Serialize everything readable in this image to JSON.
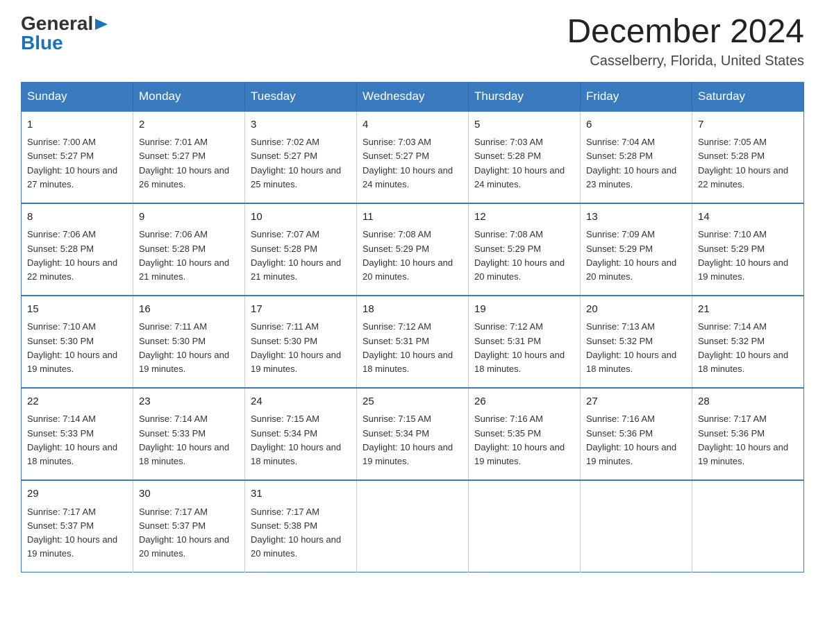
{
  "logo": {
    "general": "General",
    "blue": "Blue",
    "triangle": "▶"
  },
  "header": {
    "title": "December 2024",
    "subtitle": "Casselberry, Florida, United States"
  },
  "weekdays": [
    "Sunday",
    "Monday",
    "Tuesday",
    "Wednesday",
    "Thursday",
    "Friday",
    "Saturday"
  ],
  "weeks": [
    [
      {
        "day": "1",
        "sunrise": "7:00 AM",
        "sunset": "5:27 PM",
        "daylight": "10 hours and 27 minutes."
      },
      {
        "day": "2",
        "sunrise": "7:01 AM",
        "sunset": "5:27 PM",
        "daylight": "10 hours and 26 minutes."
      },
      {
        "day": "3",
        "sunrise": "7:02 AM",
        "sunset": "5:27 PM",
        "daylight": "10 hours and 25 minutes."
      },
      {
        "day": "4",
        "sunrise": "7:03 AM",
        "sunset": "5:27 PM",
        "daylight": "10 hours and 24 minutes."
      },
      {
        "day": "5",
        "sunrise": "7:03 AM",
        "sunset": "5:28 PM",
        "daylight": "10 hours and 24 minutes."
      },
      {
        "day": "6",
        "sunrise": "7:04 AM",
        "sunset": "5:28 PM",
        "daylight": "10 hours and 23 minutes."
      },
      {
        "day": "7",
        "sunrise": "7:05 AM",
        "sunset": "5:28 PM",
        "daylight": "10 hours and 22 minutes."
      }
    ],
    [
      {
        "day": "8",
        "sunrise": "7:06 AM",
        "sunset": "5:28 PM",
        "daylight": "10 hours and 22 minutes."
      },
      {
        "day": "9",
        "sunrise": "7:06 AM",
        "sunset": "5:28 PM",
        "daylight": "10 hours and 21 minutes."
      },
      {
        "day": "10",
        "sunrise": "7:07 AM",
        "sunset": "5:28 PM",
        "daylight": "10 hours and 21 minutes."
      },
      {
        "day": "11",
        "sunrise": "7:08 AM",
        "sunset": "5:29 PM",
        "daylight": "10 hours and 20 minutes."
      },
      {
        "day": "12",
        "sunrise": "7:08 AM",
        "sunset": "5:29 PM",
        "daylight": "10 hours and 20 minutes."
      },
      {
        "day": "13",
        "sunrise": "7:09 AM",
        "sunset": "5:29 PM",
        "daylight": "10 hours and 20 minutes."
      },
      {
        "day": "14",
        "sunrise": "7:10 AM",
        "sunset": "5:29 PM",
        "daylight": "10 hours and 19 minutes."
      }
    ],
    [
      {
        "day": "15",
        "sunrise": "7:10 AM",
        "sunset": "5:30 PM",
        "daylight": "10 hours and 19 minutes."
      },
      {
        "day": "16",
        "sunrise": "7:11 AM",
        "sunset": "5:30 PM",
        "daylight": "10 hours and 19 minutes."
      },
      {
        "day": "17",
        "sunrise": "7:11 AM",
        "sunset": "5:30 PM",
        "daylight": "10 hours and 19 minutes."
      },
      {
        "day": "18",
        "sunrise": "7:12 AM",
        "sunset": "5:31 PM",
        "daylight": "10 hours and 18 minutes."
      },
      {
        "day": "19",
        "sunrise": "7:12 AM",
        "sunset": "5:31 PM",
        "daylight": "10 hours and 18 minutes."
      },
      {
        "day": "20",
        "sunrise": "7:13 AM",
        "sunset": "5:32 PM",
        "daylight": "10 hours and 18 minutes."
      },
      {
        "day": "21",
        "sunrise": "7:14 AM",
        "sunset": "5:32 PM",
        "daylight": "10 hours and 18 minutes."
      }
    ],
    [
      {
        "day": "22",
        "sunrise": "7:14 AM",
        "sunset": "5:33 PM",
        "daylight": "10 hours and 18 minutes."
      },
      {
        "day": "23",
        "sunrise": "7:14 AM",
        "sunset": "5:33 PM",
        "daylight": "10 hours and 18 minutes."
      },
      {
        "day": "24",
        "sunrise": "7:15 AM",
        "sunset": "5:34 PM",
        "daylight": "10 hours and 18 minutes."
      },
      {
        "day": "25",
        "sunrise": "7:15 AM",
        "sunset": "5:34 PM",
        "daylight": "10 hours and 19 minutes."
      },
      {
        "day": "26",
        "sunrise": "7:16 AM",
        "sunset": "5:35 PM",
        "daylight": "10 hours and 19 minutes."
      },
      {
        "day": "27",
        "sunrise": "7:16 AM",
        "sunset": "5:36 PM",
        "daylight": "10 hours and 19 minutes."
      },
      {
        "day": "28",
        "sunrise": "7:17 AM",
        "sunset": "5:36 PM",
        "daylight": "10 hours and 19 minutes."
      }
    ],
    [
      {
        "day": "29",
        "sunrise": "7:17 AM",
        "sunset": "5:37 PM",
        "daylight": "10 hours and 19 minutes."
      },
      {
        "day": "30",
        "sunrise": "7:17 AM",
        "sunset": "5:37 PM",
        "daylight": "10 hours and 20 minutes."
      },
      {
        "day": "31",
        "sunrise": "7:17 AM",
        "sunset": "5:38 PM",
        "daylight": "10 hours and 20 minutes."
      },
      null,
      null,
      null,
      null
    ]
  ],
  "labels": {
    "sunrise": "Sunrise: ",
    "sunset": "Sunset: ",
    "daylight": "Daylight: "
  }
}
